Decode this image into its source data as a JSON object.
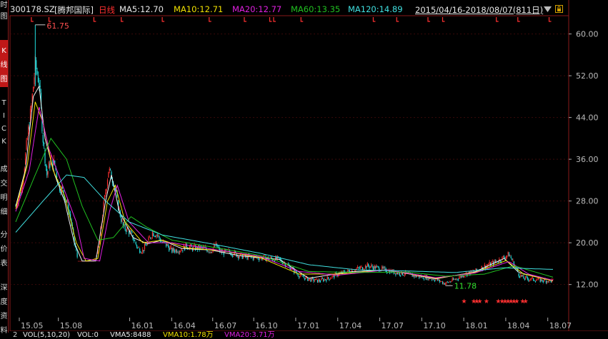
{
  "header": {
    "symbol": "300178.SZ",
    "name": "[腾邦国际]",
    "period": "日线",
    "ma5": "MA5:12.70",
    "ma10": "MA10:12.71",
    "ma20": "MA20:12.77",
    "ma60": "MA60:13.35",
    "ma120": "MA120:14.89",
    "range": "2015/04/16-2018/08/07(811日)"
  },
  "sidebar_tabs": [
    {
      "label": "时图",
      "active": false
    },
    {
      "label": "K线图",
      "active": true
    },
    {
      "label": "TICK",
      "active": false
    },
    {
      "label": "成交明细",
      "active": false
    },
    {
      "label": "分价表",
      "active": false
    },
    {
      "label": "深度资料",
      "active": false
    }
  ],
  "colors": {
    "ma5": "#f0f0f0",
    "ma10": "#f0e000",
    "ma20": "#e020e0",
    "ma60": "#20c020",
    "ma120": "#40e0e0",
    "up": "#ff3030",
    "down": "#20e0e0",
    "frame": "#8a1a1a"
  },
  "chart_data": {
    "type": "candlestick",
    "x_tick_labels": [
      "15.05",
      "15.08",
      "16.01",
      "16.04",
      "16.07",
      "16.10",
      "17.01",
      "17.04",
      "17.07",
      "17.10",
      "18.01",
      "18.04",
      "18.07"
    ],
    "y_ticks": [
      12,
      20,
      28,
      36,
      44,
      52,
      60
    ],
    "y_tick_labels": [
      "12.00",
      "20.00",
      "28.00",
      "36.00",
      "44.00",
      "52.00",
      "60.00"
    ],
    "ylim": [
      5.8,
      63.5
    ],
    "annotations": {
      "high_label": "61.75",
      "low_label": "11.78"
    },
    "price_path": [
      [
        0,
        27
      ],
      [
        6,
        30
      ],
      [
        12,
        40
      ],
      [
        16,
        46
      ],
      [
        20,
        54
      ],
      [
        24,
        51
      ],
      [
        28,
        40
      ],
      [
        32,
        33
      ],
      [
        36,
        36
      ],
      [
        40,
        35
      ],
      [
        44,
        31
      ],
      [
        48,
        30
      ],
      [
        52,
        28
      ],
      [
        56,
        25
      ],
      [
        60,
        20
      ],
      [
        64,
        16.5
      ],
      [
        70,
        16.5
      ],
      [
        80,
        16.5
      ],
      [
        85,
        19
      ],
      [
        90,
        27
      ],
      [
        95,
        34
      ],
      [
        100,
        32
      ],
      [
        105,
        27
      ],
      [
        110,
        23
      ],
      [
        115,
        22.5
      ],
      [
        120,
        21
      ],
      [
        125,
        19
      ],
      [
        130,
        18.5
      ],
      [
        135,
        20
      ],
      [
        140,
        22
      ],
      [
        145,
        21.5
      ],
      [
        150,
        20
      ],
      [
        155,
        19.5
      ],
      [
        160,
        18.5
      ],
      [
        170,
        18.8
      ],
      [
        175,
        19.5
      ],
      [
        180,
        19
      ],
      [
        190,
        19
      ],
      [
        200,
        18.5
      ],
      [
        205,
        19.5
      ],
      [
        210,
        18.2
      ],
      [
        220,
        18.2
      ],
      [
        230,
        17.5
      ],
      [
        240,
        17.2
      ],
      [
        250,
        17.2
      ],
      [
        260,
        17
      ],
      [
        270,
        16.8
      ],
      [
        280,
        15.5
      ],
      [
        290,
        13.8
      ],
      [
        300,
        13
      ],
      [
        310,
        12.7
      ],
      [
        320,
        13.2
      ],
      [
        330,
        14
      ],
      [
        340,
        14.5
      ],
      [
        350,
        15
      ],
      [
        360,
        15.6
      ],
      [
        370,
        15.2
      ],
      [
        380,
        14.7
      ],
      [
        390,
        14.3
      ],
      [
        400,
        14
      ],
      [
        410,
        13.6
      ],
      [
        420,
        13.4
      ],
      [
        430,
        13
      ],
      [
        440,
        12.2
      ],
      [
        450,
        13
      ],
      [
        460,
        14
      ],
      [
        470,
        14.5
      ],
      [
        480,
        15.5
      ],
      [
        490,
        16.2
      ],
      [
        500,
        17.2
      ],
      [
        505,
        17.8
      ],
      [
        510,
        16
      ],
      [
        515,
        14
      ],
      [
        520,
        13.2
      ],
      [
        530,
        13
      ],
      [
        540,
        12.8
      ],
      [
        550,
        12.7
      ]
    ],
    "series": [
      {
        "name": "MA5",
        "values": [
          [
            0,
            27
          ],
          [
            10,
            34
          ],
          [
            18,
            48
          ],
          [
            24,
            50
          ],
          [
            30,
            40
          ],
          [
            40,
            33
          ],
          [
            50,
            28
          ],
          [
            60,
            20
          ],
          [
            68,
            16.5
          ],
          [
            82,
            16.5
          ],
          [
            92,
            28
          ],
          [
            98,
            33
          ],
          [
            106,
            26
          ],
          [
            120,
            21
          ],
          [
            135,
            19.8
          ],
          [
            150,
            20.5
          ],
          [
            170,
            18.9
          ],
          [
            200,
            18.6
          ],
          [
            230,
            17.5
          ],
          [
            270,
            16.8
          ],
          [
            300,
            13.2
          ],
          [
            340,
            14.4
          ],
          [
            380,
            14.8
          ],
          [
            430,
            13.1
          ],
          [
            470,
            14.4
          ],
          [
            500,
            17
          ],
          [
            515,
            14.3
          ],
          [
            550,
            12.7
          ]
        ]
      },
      {
        "name": "MA10",
        "values": [
          [
            0,
            26.5
          ],
          [
            12,
            35
          ],
          [
            20,
            47
          ],
          [
            28,
            43
          ],
          [
            38,
            34
          ],
          [
            50,
            29
          ],
          [
            62,
            20
          ],
          [
            72,
            16.5
          ],
          [
            84,
            17
          ],
          [
            94,
            28
          ],
          [
            102,
            31
          ],
          [
            112,
            24
          ],
          [
            130,
            20
          ],
          [
            150,
            20.5
          ],
          [
            175,
            19
          ],
          [
            210,
            18.5
          ],
          [
            250,
            17.2
          ],
          [
            290,
            14
          ],
          [
            330,
            14
          ],
          [
            380,
            14.8
          ],
          [
            430,
            13.2
          ],
          [
            470,
            14.3
          ],
          [
            502,
            16.6
          ],
          [
            520,
            14
          ],
          [
            550,
            12.7
          ]
        ]
      },
      {
        "name": "MA20",
        "values": [
          [
            0,
            26
          ],
          [
            14,
            34
          ],
          [
            24,
            46
          ],
          [
            34,
            38
          ],
          [
            48,
            31
          ],
          [
            62,
            24
          ],
          [
            70,
            17
          ],
          [
            86,
            16.5
          ],
          [
            96,
            26
          ],
          [
            104,
            31
          ],
          [
            116,
            24
          ],
          [
            136,
            20
          ],
          [
            160,
            20
          ],
          [
            200,
            18.8
          ],
          [
            250,
            17.4
          ],
          [
            290,
            14.5
          ],
          [
            330,
            13.8
          ],
          [
            380,
            14.8
          ],
          [
            430,
            13.3
          ],
          [
            470,
            14.2
          ],
          [
            505,
            16.4
          ],
          [
            525,
            14
          ],
          [
            550,
            12.8
          ]
        ]
      },
      {
        "name": "MA60",
        "values": [
          [
            0,
            24
          ],
          [
            20,
            33
          ],
          [
            36,
            40
          ],
          [
            52,
            36
          ],
          [
            68,
            27
          ],
          [
            84,
            20.5
          ],
          [
            100,
            21
          ],
          [
            118,
            25
          ],
          [
            134,
            23
          ],
          [
            160,
            20.5
          ],
          [
            200,
            19.2
          ],
          [
            250,
            17.6
          ],
          [
            300,
            14.5
          ],
          [
            350,
            14.3
          ],
          [
            400,
            14.4
          ],
          [
            440,
            13.6
          ],
          [
            480,
            14
          ],
          [
            510,
            15.6
          ],
          [
            550,
            13.4
          ]
        ]
      },
      {
        "name": "MA120",
        "values": [
          [
            0,
            22
          ],
          [
            28,
            28
          ],
          [
            52,
            33
          ],
          [
            70,
            32.5
          ],
          [
            92,
            28
          ],
          [
            116,
            24
          ],
          [
            150,
            21.5
          ],
          [
            200,
            19.8
          ],
          [
            250,
            18
          ],
          [
            300,
            15.8
          ],
          [
            350,
            14.8
          ],
          [
            400,
            14.6
          ],
          [
            450,
            14.3
          ],
          [
            500,
            15.2
          ],
          [
            550,
            14.9
          ]
        ]
      }
    ]
  },
  "bottom_bar": {
    "tab": "2",
    "vol": "VOL(5,10,20)",
    "vol_val": "VOL:0",
    "vma5": "VMA5:8488",
    "vma10": "VMA10:1.78万",
    "vma20": "VMA20:3.71万"
  }
}
